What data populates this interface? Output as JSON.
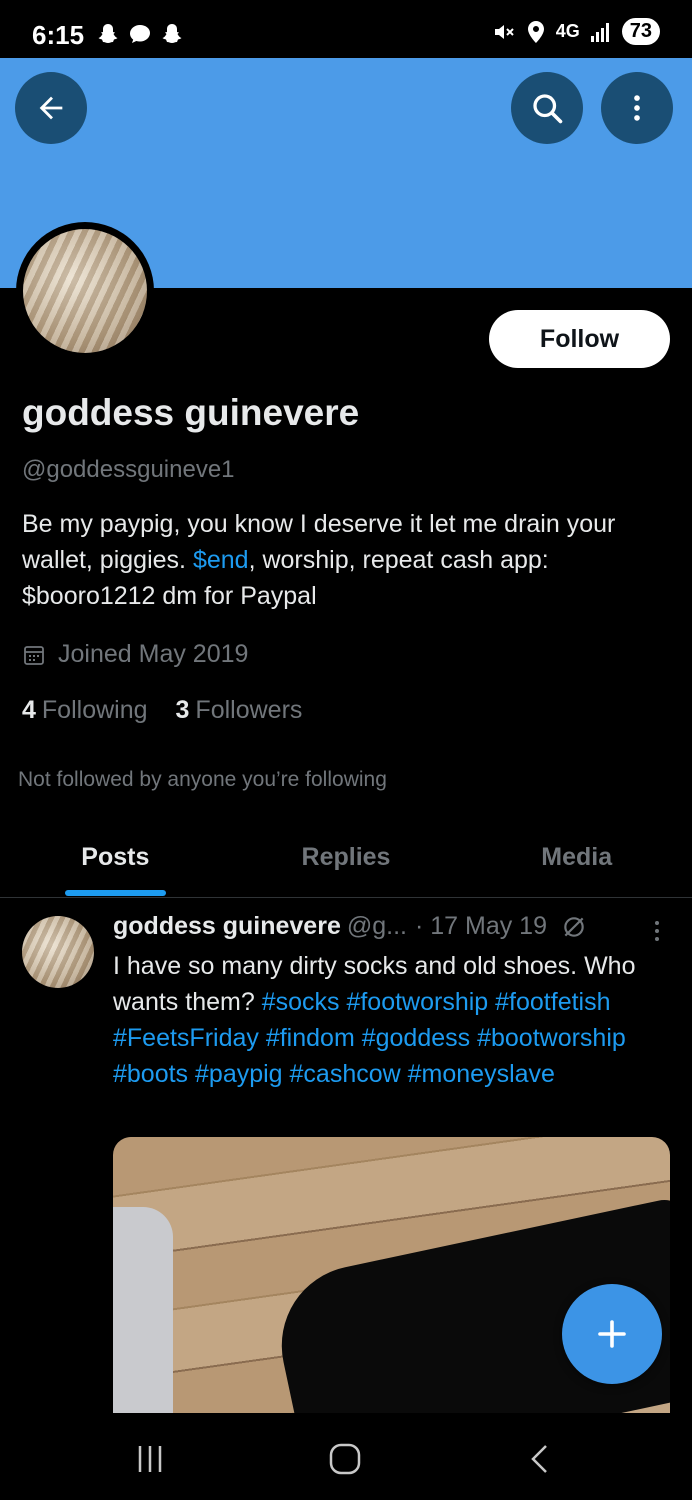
{
  "status_bar": {
    "time": "6:15",
    "network": "4G",
    "battery": "73"
  },
  "profile": {
    "display_name": "goddess guinevere",
    "handle": "@goddessguineve1",
    "follow_label": "Follow",
    "bio_part1": "Be my paypig, you know I deserve it let me drain your wallet, piggies. ",
    "bio_cashtag": "$end",
    "bio_part2": ", worship, repeat cash app: $booro1212 dm for Paypal",
    "joined": "Joined May 2019",
    "following_count": "4",
    "following_label": "Following",
    "followers_count": "3",
    "followers_label": "Followers",
    "not_followed": "Not followed by anyone you’re following"
  },
  "tabs": [
    {
      "label": "Posts",
      "active": true
    },
    {
      "label": "Replies",
      "active": false
    },
    {
      "label": "Media",
      "active": false
    }
  ],
  "post": {
    "name": "goddess guinevere",
    "handle": "@g...",
    "date": "· 17 May 19",
    "text": "I have so many dirty socks and old shoes. Who wants them?",
    "hashtags": "#socks #footworship #footfetish #FeetsFriday #findom #goddess #bootworship #boots #paypig #cashcow #moneyslave"
  },
  "colors": {
    "banner": "#4c9be8",
    "accent": "#1d9bf0",
    "fab": "#3c94e6"
  },
  "icons": {
    "back": "arrow-left-icon",
    "search": "search-icon",
    "more": "more-vertical-icon",
    "calendar": "calendar-icon",
    "compose": "plus-icon"
  }
}
